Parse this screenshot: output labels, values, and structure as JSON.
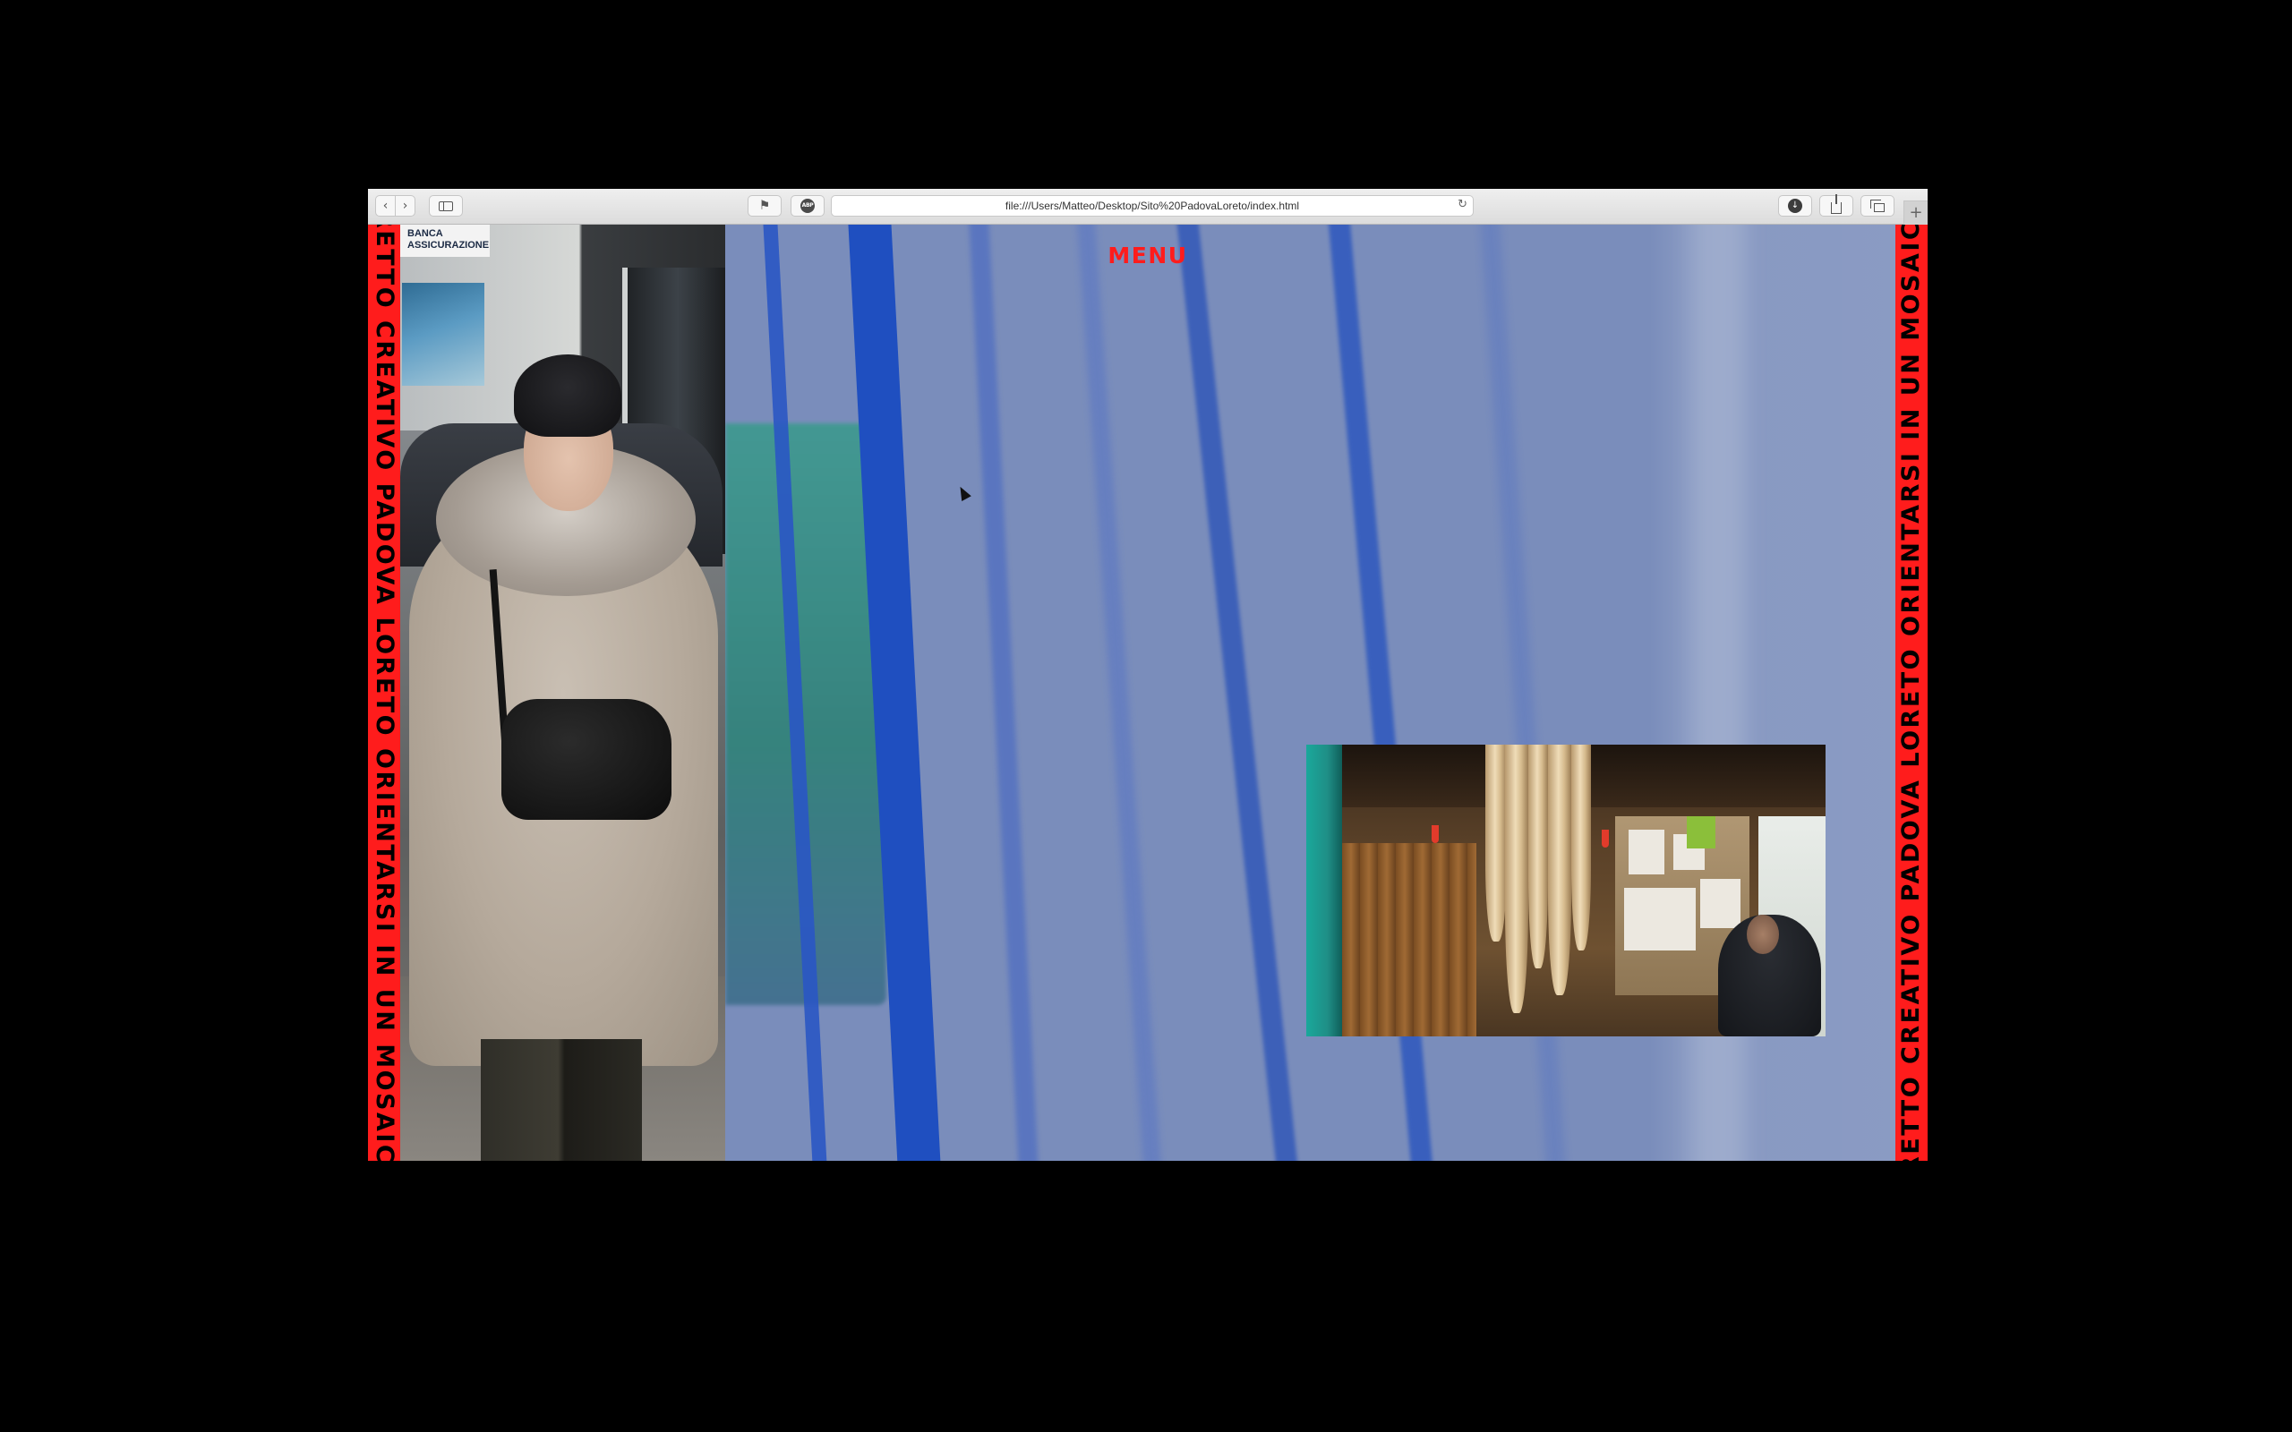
{
  "browser": {
    "url": "file:///Users/Matteo/Desktop/Sito%20PadovaLoreto/index.html",
    "back_glyph": "‹",
    "forward_glyph": "›",
    "newtab_glyph": "+",
    "reload_glyph": "↻",
    "download_glyph": "↓",
    "adblock_glyph": "ABP",
    "extension_glyph": "⚑"
  },
  "page": {
    "menu_label": "MENU",
    "left_band_text": "RETTO CREATIVO PADOVA LORETO     ORIENTARSI IN UN MOSAIC",
    "right_band_text": "RETTO CREATIVO PADOVA LORETO     ORIENTARSI IN UN MOSAIC",
    "left_photo_sign": "BANCA\nASSICURAZIONE"
  },
  "colors": {
    "accent_red": "#ff1c1c",
    "background_blue": "#7a8dbb",
    "stripe_blue": "#2a56c4"
  }
}
